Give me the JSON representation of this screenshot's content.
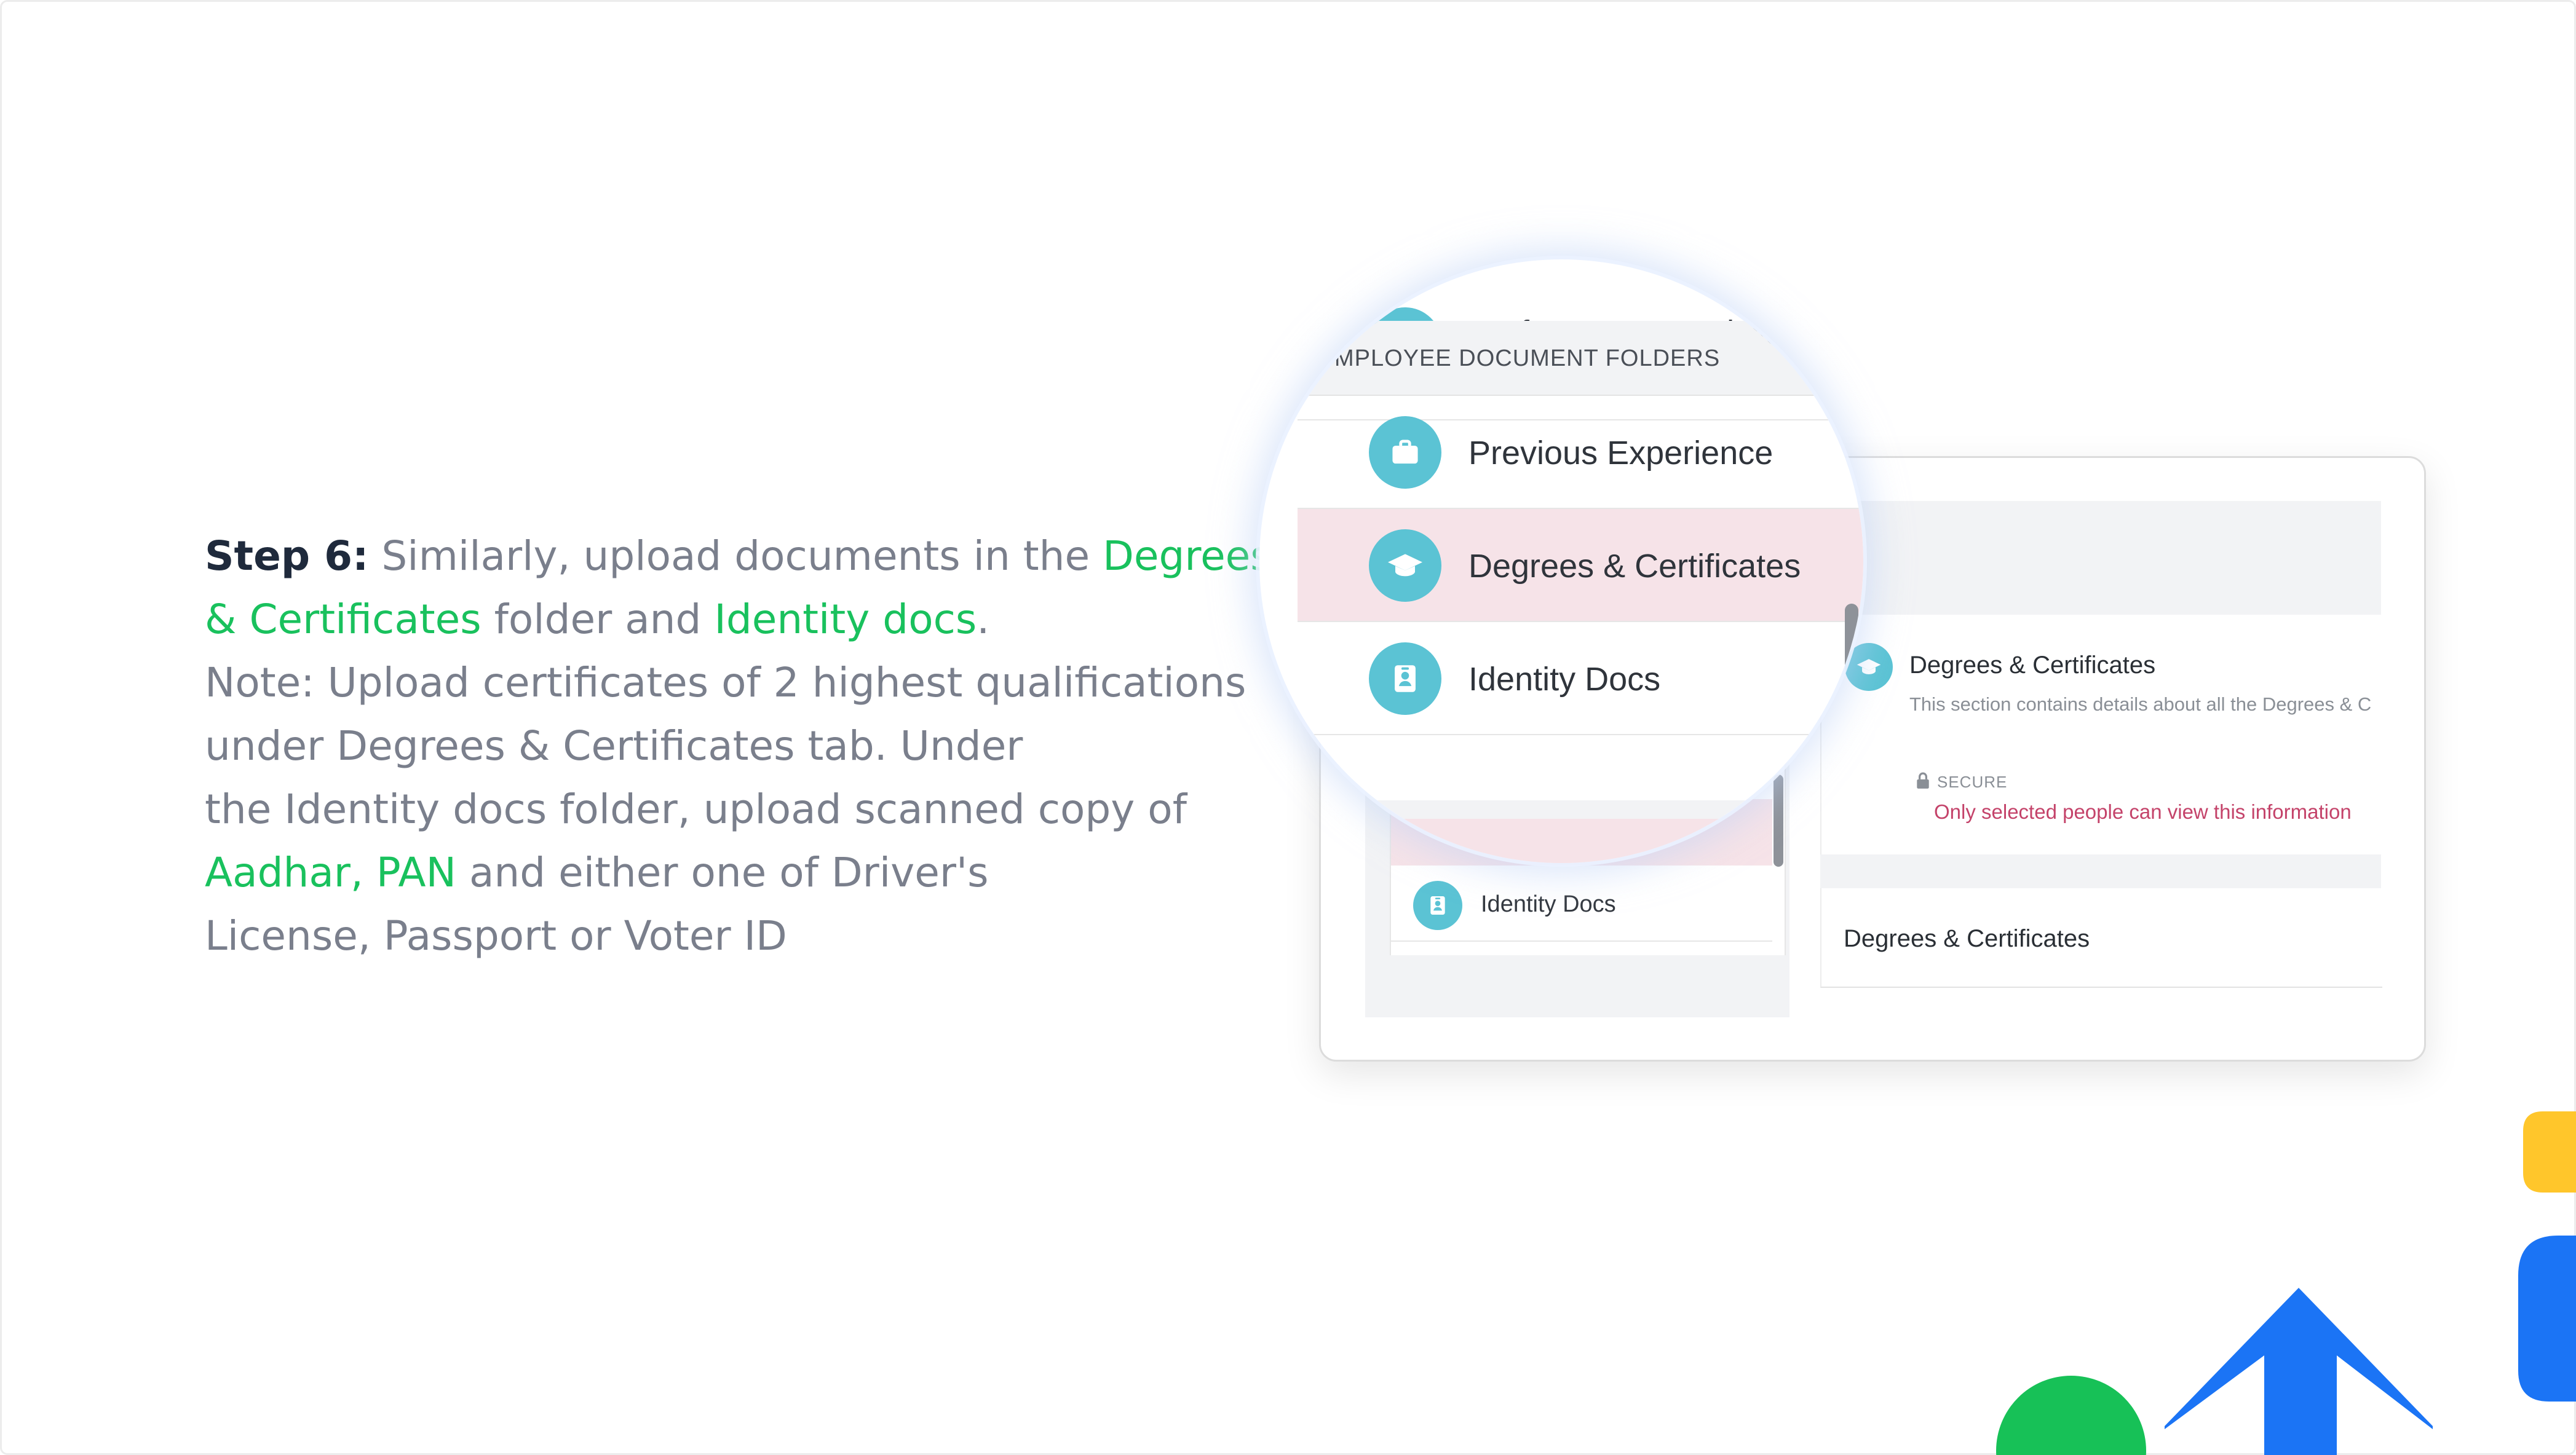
{
  "instruction": {
    "line1": {
      "bold": "Step 6:",
      "plain": " Similarly, upload documents in the ",
      "green": "Degrees"
    },
    "line2": {
      "green": "& Certificates",
      "plain": " folder and ",
      "green2": "Identity docs",
      "tail": "."
    },
    "line3": "Note: Upload certificates of 2 highest qualifications",
    "line4": "under Degrees & Certificates tab. Under",
    "line5": "the  Identity docs folder, upload scanned copy of",
    "line6": {
      "green": "Aadhar, PAN",
      "plain": " and either one of Driver's"
    },
    "line7": "License,  Passport or Voter ID"
  },
  "magnifier": {
    "header": "MPLOYEE DOCUMENT FOLDERS",
    "folders": [
      {
        "label": "Performance Reviews",
        "icon": "document-icon",
        "active": false
      },
      {
        "label": "Previous Experience",
        "icon": "briefcase-icon",
        "active": false
      },
      {
        "label": "Degrees & Certificates",
        "icon": "graduation-cap-icon",
        "active": true
      },
      {
        "label": "Identity Docs",
        "icon": "id-badge-icon",
        "active": false
      }
    ]
  },
  "panel": {
    "small_item_label": "Identity Docs",
    "section_title": "Degrees & Certificates",
    "section_description": "This section contains details about all the Degrees & C",
    "secure_label": "SECURE",
    "secure_note": "Only selected people can view this information",
    "section_title_2": "Degrees & Certificates"
  },
  "colors": {
    "accent_green": "#19c15d",
    "icon_teal": "#5bc3d4",
    "active_row": "#f6e3e8",
    "secure_red": "#c4436a",
    "deco_blue": "#1b74f5",
    "deco_yellow": "#ffc62b",
    "deco_green": "#17c157"
  }
}
